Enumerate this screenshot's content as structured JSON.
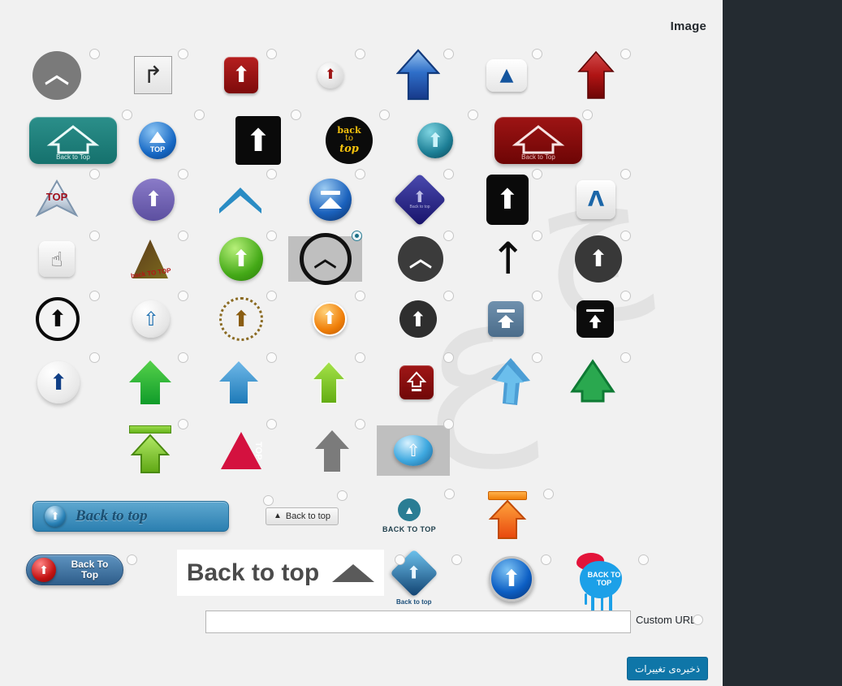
{
  "page": {
    "title": "Image",
    "background_color": "#f1f1f1",
    "rail_color": "#242b31"
  },
  "form": {
    "custom_url_label": "Custom URL",
    "custom_url_value": "",
    "custom_url_placeholder": "",
    "save_label": "ذخیره‌ی تغییرات",
    "save_color": "#0f76a8"
  },
  "grid": {
    "columns": 7,
    "selected_index": 24,
    "rows": [
      [
        {
          "name": "gray-circle-chevron-icon",
          "label": "",
          "selected": false
        },
        {
          "name": "uturn-arrow-square-icon",
          "label": "",
          "selected": false
        },
        {
          "name": "red-rounded-square-arrow-icon",
          "label": "",
          "selected": false
        },
        {
          "name": "white-ball-red-arrow-icon",
          "label": "",
          "selected": false
        },
        {
          "name": "blue-gradient-arrow-icon",
          "label": "",
          "selected": false
        },
        {
          "name": "white-pill-blue-triangle-icon",
          "label": "",
          "selected": false
        },
        {
          "name": "red-gradient-arrow-icon",
          "label": "",
          "selected": false
        }
      ],
      [
        {
          "name": "teal-back-to-top-button-icon",
          "label": "Back to Top",
          "selected": false
        },
        {
          "name": "blue-orb-top-icon",
          "label": "TOP",
          "selected": false
        },
        {
          "name": "black-square-white-arrow-icon",
          "label": "",
          "selected": false
        },
        {
          "name": "black-circle-back-to-top-icon",
          "label": "back to top",
          "selected": false
        },
        {
          "name": "teal-orb-arrow-icon",
          "label": "",
          "selected": false
        },
        {
          "name": "dark-red-back-to-top-button-icon",
          "label": "Back to Top",
          "selected": false
        },
        {
          "name": "empty-cell",
          "label": "",
          "selected": false
        }
      ],
      [
        {
          "name": "top-dart-icon",
          "label": "TOP",
          "selected": false
        },
        {
          "name": "purple-circle-arrow-icon",
          "label": "",
          "selected": false
        },
        {
          "name": "blue-chevron-icon",
          "label": "",
          "selected": false
        },
        {
          "name": "blue-eject-circle-icon",
          "label": "",
          "selected": false
        },
        {
          "name": "navy-diamond-back-to-top-icon",
          "label": "Back to top",
          "selected": false
        },
        {
          "name": "black-rounded-rect-arrow-icon",
          "label": "",
          "selected": false
        },
        {
          "name": "light-square-blue-caret-icon",
          "label": "",
          "selected": false
        }
      ],
      [
        {
          "name": "hand-pointer-square-icon",
          "label": "",
          "selected": false
        },
        {
          "name": "brown-triangle-back-to-top-icon",
          "label": "back TO TOP",
          "selected": false
        },
        {
          "name": "green-circle-arrow-icon",
          "label": "",
          "selected": false
        },
        {
          "name": "ring-chevron-icon",
          "label": "",
          "selected": true
        },
        {
          "name": "dark-circle-chevron-icon",
          "label": "",
          "selected": false
        },
        {
          "name": "plain-black-arrow-icon",
          "label": "",
          "selected": false
        },
        {
          "name": "dark-circle-small-arrow-icon",
          "label": "",
          "selected": false
        }
      ],
      [
        {
          "name": "outline-circle-black-arrow-icon",
          "label": "",
          "selected": false
        },
        {
          "name": "white-ball-blue-outline-arrow-icon",
          "label": "",
          "selected": false
        },
        {
          "name": "dotted-circle-brown-arrow-icon",
          "label": "",
          "selected": false
        },
        {
          "name": "orange-circle-arrow-icon",
          "label": "",
          "selected": false
        },
        {
          "name": "dark-circle-fat-arrow-icon",
          "label": "",
          "selected": false
        },
        {
          "name": "steel-blue-square-arrow-icon",
          "label": "",
          "selected": false
        },
        {
          "name": "black-square-bar-arrow-icon",
          "label": "",
          "selected": false
        }
      ],
      [
        {
          "name": "white-ball-navy-arrow-icon",
          "label": "",
          "selected": false
        },
        {
          "name": "green-3d-arrow-icon",
          "label": "",
          "selected": false
        },
        {
          "name": "blue-3d-arrow-icon",
          "label": "",
          "selected": false
        },
        {
          "name": "lime-3d-arrow-icon",
          "label": "",
          "selected": false
        },
        {
          "name": "dark-red-square-line-arrow-icon",
          "label": "",
          "selected": false
        },
        {
          "name": "blue-perspective-arrow-icon",
          "label": "",
          "selected": false
        },
        {
          "name": "green-outline-arrow-icon",
          "label": "",
          "selected": false
        }
      ],
      [
        {
          "name": "empty-cell",
          "label": "",
          "selected": false
        },
        {
          "name": "green-bar-arrow-icon",
          "label": "",
          "selected": false
        },
        {
          "name": "red-triangle-top-icon",
          "label": "TOP",
          "selected": false
        },
        {
          "name": "gray-flat-arrow-icon",
          "label": "",
          "selected": false
        },
        {
          "name": "blue-orb-gray-box-icon",
          "label": "",
          "selected": false
        },
        {
          "name": "empty-cell",
          "label": "",
          "selected": false
        },
        {
          "name": "empty-cell",
          "label": "",
          "selected": false
        }
      ]
    ],
    "wide_rows": [
      [
        {
          "name": "blue-bar-back-to-top-button",
          "label": "Back to top",
          "selected": false
        },
        {
          "name": "small-gray-back-to-top-button",
          "label": "Back to top",
          "selected": false
        },
        {
          "name": "teal-round-back-to-top-icon",
          "label": "BACK TO TOP",
          "selected": false
        },
        {
          "name": "orange-bar-arrow-icon",
          "label": "",
          "selected": false
        }
      ],
      [
        {
          "name": "blue-pill-back-to-top-button",
          "label": "Back To Top",
          "selected": false
        },
        {
          "name": "white-big-back-to-top-button",
          "label": "Back to top",
          "selected": false
        },
        {
          "name": "blue-diamond-back-to-top-icon",
          "label": "Back to top",
          "selected": false
        },
        {
          "name": "big-blue-round-arrow-icon",
          "label": "",
          "selected": false
        },
        {
          "name": "paint-splatter-back-to-top-icon",
          "label": "BACK TO TOP",
          "selected": false
        }
      ]
    ]
  }
}
